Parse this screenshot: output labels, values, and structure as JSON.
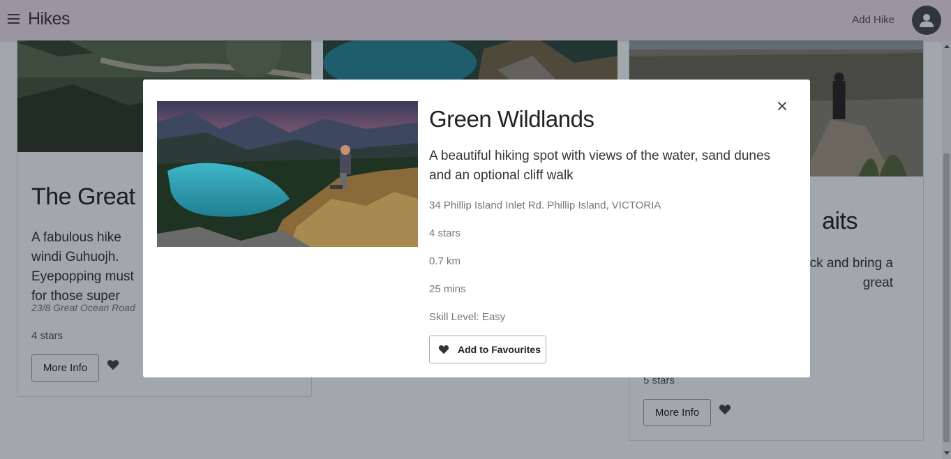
{
  "navbar": {
    "brand": "Hikes",
    "add_hike_label": "Add Hike"
  },
  "cards": [
    {
      "title": "The Great Es",
      "description": "A fabulous hike windi Guhuojh. Eyepopping must for those super",
      "address": "23/8 Great Ocean Road",
      "stars": "4 stars",
      "more_info_label": "More Info"
    },
    {
      "title": "aits",
      "description": "rough hanging aves and rock and bring a great",
      "stars": "5 stars",
      "more_info_label": "More Info"
    }
  ],
  "modal": {
    "title": "Green Wildlands",
    "description": "A beautiful hiking spot with views of the water, sand dunes and an optional cliff walk",
    "address": "34 Phillip Island Inlet Rd. Phillip Island, VICTORIA",
    "rating": "4 stars",
    "distance": "0.7 km",
    "duration": "25 mins",
    "skill_level": "Skill Level: Easy",
    "favourite_label": "Add to Favourites"
  },
  "icons": {
    "menu": "hamburger-icon",
    "avatar": "user-icon",
    "close": "close-icon",
    "heart": "heart-icon"
  },
  "colors": {
    "navbar_bg": "#f3e4ea",
    "avatar_bg": "#4a4a50",
    "overlay": "rgba(10,20,40,0.38)"
  }
}
